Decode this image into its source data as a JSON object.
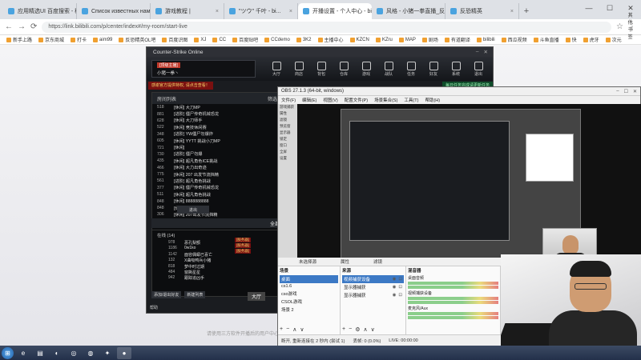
{
  "browser": {
    "tabs": [
      {
        "label": "应用精选UI 百度搜索 - 科技"
      },
      {
        "label": "Список известных нам карт"
      },
      {
        "label": "游戏教程 | "
      },
      {
        "label": "\"ツウ\" 千叶 - bi..."
      },
      {
        "label": "开播设置 - 个人中心 - bilibili..."
      },
      {
        "label": "风格 - 小猪一拳直播_反恐精英"
      },
      {
        "label": "反恐精英"
      }
    ],
    "active_tab": 4,
    "url": "https://link.bilibili.com/p/center/index#/my-room/start-live",
    "bookmarks": [
      "新手上路",
      "京东商城",
      "打卡",
      "aim99",
      "反恐精英OL吧",
      "百度识图",
      "XJ",
      "CC",
      "百度贴吧",
      "CCdemo",
      "3K2",
      "主播中心",
      "KZCN",
      "KZru",
      "MAP",
      "剧场",
      "有道翻译",
      "bilibili",
      "西瓜视频",
      "斗鱼直播",
      "快",
      "虎牙",
      "次元"
    ],
    "bookmarks_right": [
      "其他书签",
      "移动设备上的书签"
    ],
    "page_hint": "请使用三方软件开播后的用户中心设置"
  },
  "cso": {
    "title": "Counter-Strike Online",
    "player": {
      "badge": "[顶级主播]",
      "name": "小猪一拳丶"
    },
    "nav": [
      "大厅",
      "商店",
      "背包",
      "仓库",
      "游戏",
      "战队",
      "任务",
      "好友",
      "系统",
      "退出"
    ],
    "banner_left": "感谢官方提供特权, 请点击查看！",
    "banner_right": "每日任务完成请更新任务",
    "list_header": {
      "left": "房间列表",
      "right": "筛选"
    },
    "rooms": [
      {
        "n": "518",
        "name": "[休闲] 大刀MP"
      },
      {
        "n": "881",
        "name": "[进阶] 僵尸传奇机械恐龙"
      },
      {
        "n": "628",
        "name": "[休闲] 大刀师手"
      },
      {
        "n": "522",
        "name": "[休闲] 竞技休闲赛"
      },
      {
        "n": "348",
        "name": "[进阶] YW僵尸勿爆炸"
      },
      {
        "n": "605",
        "name": "[休闲] YYTT 挑战小刀MP"
      },
      {
        "n": "721",
        "name": "[休闲]"
      },
      {
        "n": "730",
        "name": "[进阶] 僵尸勿爆"
      },
      {
        "n": "435",
        "name": "[休闲] 超凡角色ICE挑战"
      },
      {
        "n": "466",
        "name": "[休闲] 大力出奇迹"
      },
      {
        "n": "775",
        "name": "[休闲] 207 出发节流挡精"
      },
      {
        "n": "561",
        "name": "[进阶] 超凡角色挑战"
      },
      {
        "n": "377",
        "name": "[休闲] 僵尸传奇机械恐龙"
      },
      {
        "n": "511",
        "name": "[休闲] 超凡角色挑战"
      },
      {
        "n": "848",
        "name": "[休闲] 8888888888"
      },
      {
        "n": "848",
        "name": "[休闲] AWP小刀"
      },
      {
        "n": "306",
        "name": "[休闲] 207出发节流挡精"
      }
    ],
    "enter_label": "进出",
    "online_tab": "全部",
    "online_header": "在线 (14)",
    "online": [
      {
        "n": "978",
        "name": "恶孔梨额"
      },
      {
        "n": "1186",
        "name": "0w1ko"
      },
      {
        "n": "1142",
        "name": "面容偶蟒已喜亡"
      },
      {
        "n": "132",
        "name": "X曲吸鸭兵小猪"
      },
      {
        "n": "818",
        "name": "梦中时过期"
      },
      {
        "n": "484",
        "name": "窗撕星星"
      },
      {
        "n": "942",
        "name": "跟踪追凶手"
      }
    ],
    "side_tags": [
      "[服务器]",
      "[服务器]",
      "[服务器]"
    ],
    "bottom_btns": [
      "添加/退出好友",
      "新建列表"
    ],
    "hall_label": "大厅",
    "help": "帮助",
    "action_btns": [
      "新建房间",
      "收藏墙观赛"
    ]
  },
  "obs": {
    "title": "OBS 27.1.3 (64-bit, windows)",
    "menu": [
      "文件(F)",
      "编辑(E)",
      "视图(V)",
      "配置文件(P)",
      "场景集合(S)",
      "工具(T)",
      "帮助(H)"
    ],
    "left_labels": [
      "游戏捕获",
      "属性",
      "滤镜",
      "预览窗",
      "显示器",
      "锁定",
      "窗口",
      "全屏",
      "设置"
    ],
    "no_source": "未选择源",
    "panel_tabs": [
      "场景",
      "来源",
      "混音器"
    ],
    "props_label": "属性",
    "filters_label": "滤镜",
    "scenes": [
      {
        "name": "桌面",
        "sel": true
      },
      {
        "name": "cs1.6",
        "sel": false
      },
      {
        "name": "cso游戏",
        "sel": false
      },
      {
        "name": "CSOL游戏",
        "sel": false
      },
      {
        "name": "场景 2",
        "sel": false
      }
    ],
    "sources": [
      {
        "name": "视频捕获设备",
        "sel": true
      },
      {
        "name": "显示器捕获",
        "sel": false
      },
      {
        "name": "显示器捕获",
        "sel": false
      }
    ],
    "mixer": [
      {
        "label": "桌面音频"
      },
      {
        "label": "视频捕获设备"
      },
      {
        "label": "麦克风/Aux"
      }
    ],
    "status": {
      "fps": "帧率: 0 / 0.0",
      "drop": "丢帧: 0 (0.0%)",
      "live": "LIVE: 00:00:00",
      "rec": "REC: 00:00:00",
      "cpu": "CPU: 3.8%, 60.00 fps"
    },
    "status_left": "断开, 重新连接在 2 秒内 (尝试 1)"
  },
  "taskbar": {
    "apps": [
      "start-button",
      "ie-browser",
      "file-explorer",
      "firefox",
      "steam",
      "chrome",
      "counter-strike",
      "obs"
    ]
  },
  "colors": {
    "obs_selection": "#3c79c5",
    "cso_banner": "#7a1010",
    "taskbar": "#23304a"
  }
}
